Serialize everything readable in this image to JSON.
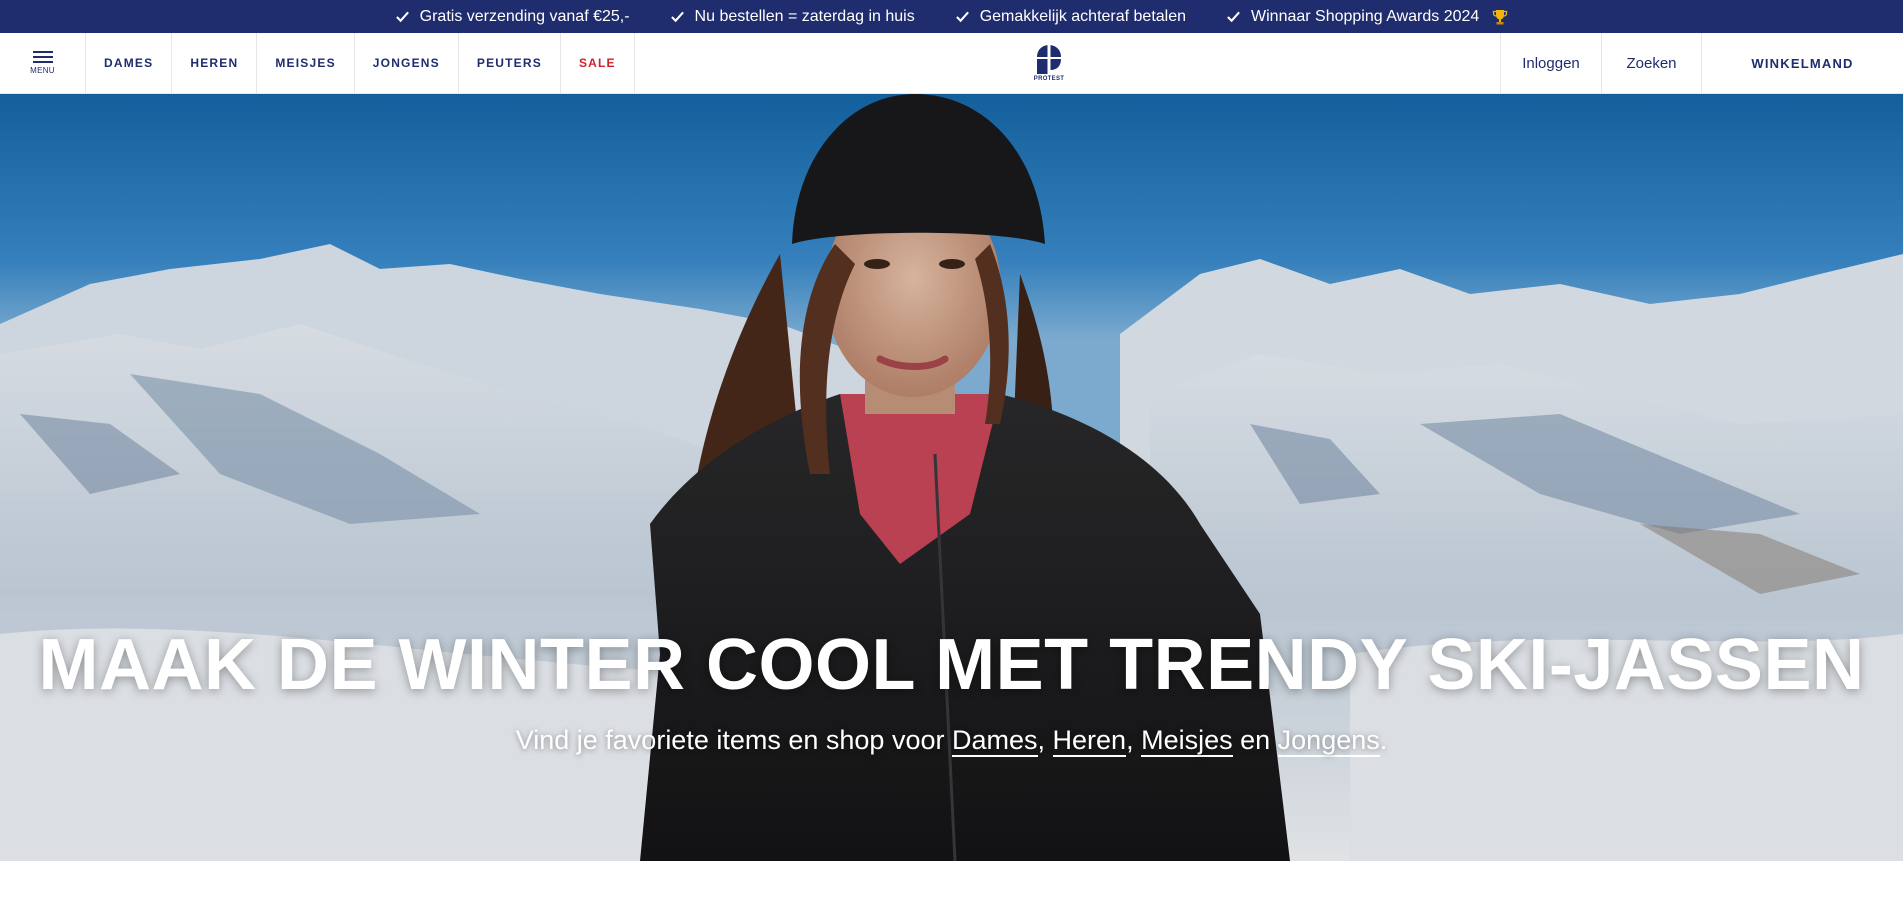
{
  "usp_bar": {
    "items": [
      "Gratis verzending vanaf €25,-",
      "Nu bestellen = zaterdag in huis",
      "Gemakkelijk achteraf betalen",
      "Winnaar Shopping Awards 2024"
    ],
    "trophy_icon": "trophy-icon"
  },
  "nav": {
    "menu_label": "MENU",
    "links": [
      "DAMES",
      "HEREN",
      "MEISJES",
      "JONGENS",
      "PEUTERS",
      "SALE"
    ],
    "logo_text": "PROTEST",
    "login": "Inloggen",
    "search": "Zoeken",
    "cart": "WINKELMAND"
  },
  "hero": {
    "title": "MAAK DE WINTER COOL MET TRENDY SKI-JASSEN",
    "subtitle_prefix": "Vind je favoriete items en shop voor ",
    "links": [
      "Dames",
      "Heren",
      "Meisjes",
      "Jongens"
    ],
    "sep_comma": ", ",
    "sep_and": " en ",
    "suffix": "."
  },
  "colors": {
    "brand_navy": "#1f2c6e",
    "sale_red": "#d0202b",
    "white": "#ffffff"
  }
}
